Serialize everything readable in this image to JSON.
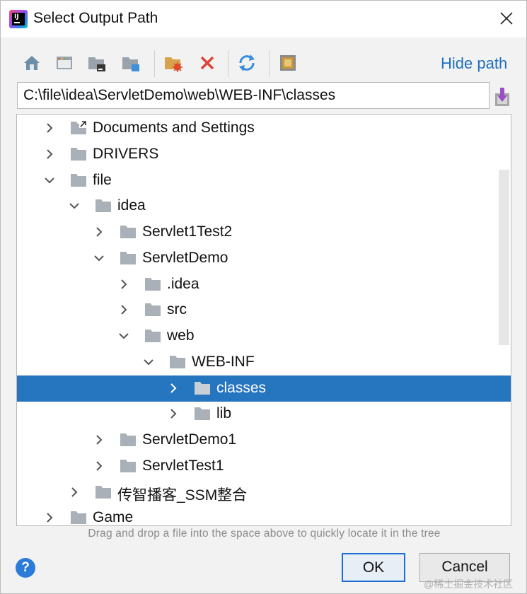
{
  "window": {
    "title": "Select Output Path"
  },
  "toolbar": {
    "buttons": [
      {
        "name": "home-icon"
      },
      {
        "name": "desktop-icon"
      },
      {
        "name": "project-icon"
      },
      {
        "name": "module-icon"
      },
      {
        "name": "new-folder-icon"
      },
      {
        "name": "delete-icon"
      },
      {
        "name": "refresh-icon"
      },
      {
        "name": "show-hidden-icon"
      }
    ],
    "hide_path_label": "Hide path"
  },
  "path": {
    "value": "C:\\file\\idea\\ServletDemo\\web\\WEB-INF\\classes"
  },
  "tree": {
    "items": [
      {
        "label": "Documents and Settings",
        "depth": 0,
        "expanded": false,
        "special": "link"
      },
      {
        "label": "DRIVERS",
        "depth": 0,
        "expanded": false
      },
      {
        "label": "file",
        "depth": 0,
        "expanded": true
      },
      {
        "label": "idea",
        "depth": 1,
        "expanded": true
      },
      {
        "label": "Servlet1Test2",
        "depth": 2,
        "expanded": false
      },
      {
        "label": "ServletDemo",
        "depth": 2,
        "expanded": true
      },
      {
        "label": ".idea",
        "depth": 3,
        "expanded": false
      },
      {
        "label": "src",
        "depth": 3,
        "expanded": false
      },
      {
        "label": "web",
        "depth": 3,
        "expanded": true
      },
      {
        "label": "WEB-INF",
        "depth": 4,
        "expanded": true
      },
      {
        "label": "classes",
        "depth": 5,
        "expanded": false,
        "selected": true
      },
      {
        "label": "lib",
        "depth": 5,
        "expanded": false
      },
      {
        "label": "ServletDemo1",
        "depth": 2,
        "expanded": false
      },
      {
        "label": "ServletTest1",
        "depth": 2,
        "expanded": false
      },
      {
        "label": "传智播客_SSM整合",
        "depth": 1,
        "expanded": false
      },
      {
        "label": "Game",
        "depth": 0,
        "expanded": false
      }
    ]
  },
  "hint": "Drag and drop a file into the space above to quickly locate it in the tree",
  "buttons": {
    "help": "?",
    "ok": "OK",
    "cancel": "Cancel"
  },
  "watermark": "@稀土掘金技术社区",
  "colors": {
    "selection": "#2675bf",
    "link": "#1e6fbf",
    "ok_border": "#1c6ed1"
  }
}
